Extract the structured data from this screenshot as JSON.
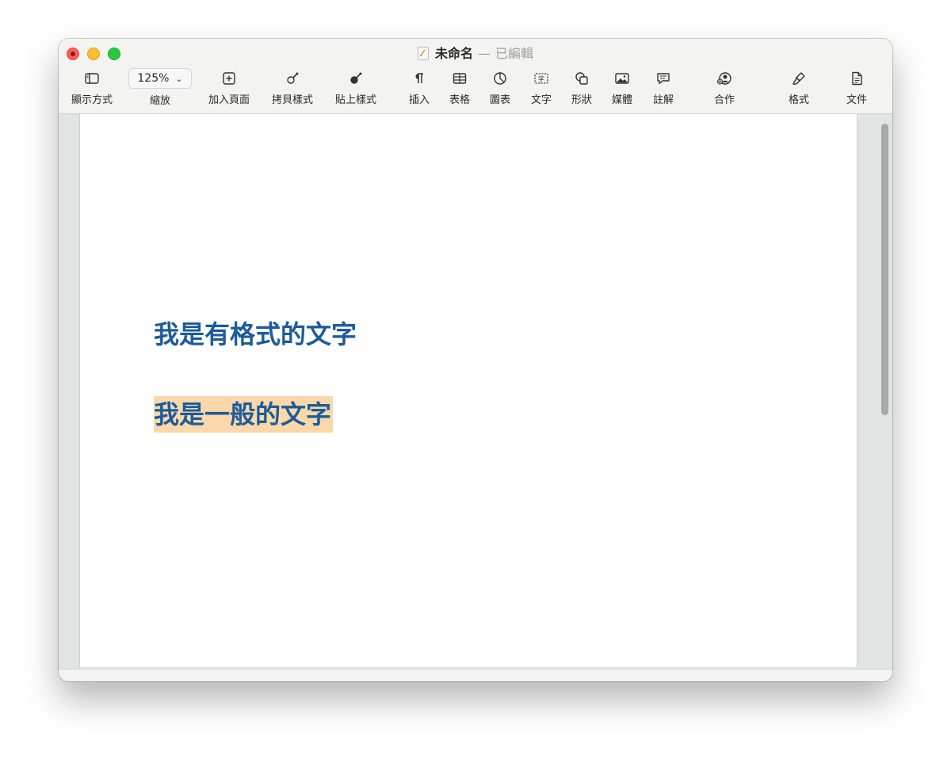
{
  "window": {
    "title": "未命名",
    "separator": "—",
    "status": "已編輯"
  },
  "toolbar": {
    "view": "顯示方式",
    "zoom_value": "125%",
    "zoom": "縮放",
    "add_page": "加入頁面",
    "copy_style": "拷貝樣式",
    "paste_style": "貼上樣式",
    "insert": "插入",
    "table": "表格",
    "chart": "圖表",
    "text": "文字",
    "shape": "形狀",
    "media": "媒體",
    "comment": "註解",
    "collaborate": "合作",
    "format": "格式",
    "document": "文件"
  },
  "document": {
    "formatted_text": "我是有格式的文字",
    "plain_text": "我是一般的文字",
    "text_color": "#1c5c9a",
    "highlight_color": "#fbd8a9"
  }
}
